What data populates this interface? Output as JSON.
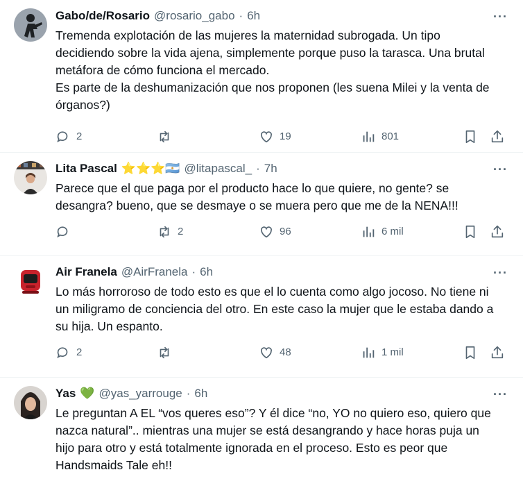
{
  "tweets": [
    {
      "name": "Gabo/de/Rosario",
      "handle": "@rosario_gabo",
      "time": "6h",
      "text": "Tremenda explotación de las mujeres la maternidad subrogada. Un tipo decidiendo sobre la vida ajena, simplemente porque puso la tarasca. Una brutal metáfora de cómo funciona el mercado.\nEs parte de la deshumanización que nos proponen (les suena Milei y la venta de órganos?)",
      "replies": "2",
      "retweets": "",
      "likes": "19",
      "views": "801"
    },
    {
      "name": "Lita Pascal",
      "badges": "⭐⭐⭐🇦🇷",
      "handle": "@litapascal_",
      "time": "7h",
      "text": "Parece que el que paga por el producto hace lo que quiere, no gente? se desangra? bueno, que se desmaye o se muera pero que me de la NENA!!!",
      "replies": "",
      "retweets": "2",
      "likes": "96",
      "views": "6 mil"
    },
    {
      "name": "Air Franela",
      "handle": "@AirFranela",
      "time": "6h",
      "text": "Lo más horroroso de todo esto es que el lo cuenta como algo jocoso. No tiene ni un miligramo de conciencia del otro. En este caso la mujer que le estaba dando a su hija. Un espanto.",
      "replies": "2",
      "retweets": "",
      "likes": "48",
      "views": "1 mil"
    },
    {
      "name": "Yas",
      "badges": "💚",
      "handle": "@yas_yarrouge",
      "time": "6h",
      "text": "Le preguntan A EL “vos queres eso”? Y él dice “no, YO no quiero eso, quiero que nazca natural”.. mientras una mujer se está desangrando y hace horas puja un hijo para otro y está totalmente ignorada en el proceso. Esto es peor que Handsmaids Tale eh!!"
    }
  ],
  "dot": "·",
  "more_label": "···"
}
